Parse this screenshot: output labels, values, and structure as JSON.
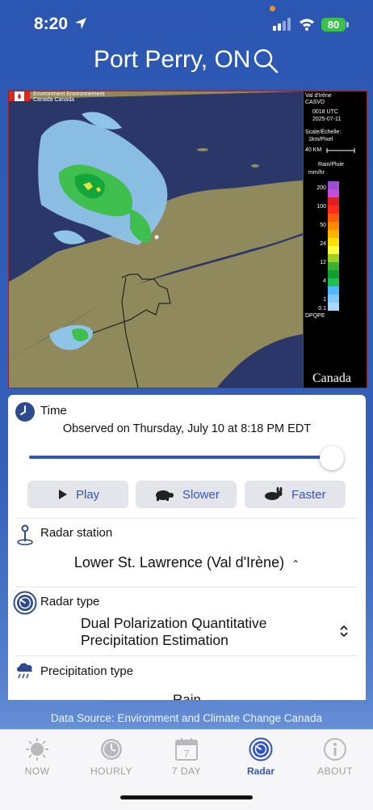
{
  "status_bar": {
    "time": "8:20",
    "battery": "80"
  },
  "header": {
    "title": "Port Perry, ON"
  },
  "radar": {
    "agency_label_line1": "Environment Environnement",
    "agency_label_line2": "Canada        Canada",
    "legend": {
      "station": "Val d'Irène",
      "station_code": "CASVD",
      "time": "0018 UTC",
      "date": "2025-07-11",
      "scale_label": "Scale/Échelle:",
      "scale_value": "1km/Pixel",
      "distance": "40 KM",
      "precip_label": "Rain/Pluie",
      "units": "mm/hr",
      "ticks": [
        "200",
        "100",
        "50",
        "24",
        "12",
        "4",
        "1",
        "0.1"
      ],
      "product": "DPQPE",
      "wordmark": "Canada"
    }
  },
  "time_section": {
    "label": "Time",
    "observed": "Observed on Thursday, July 10 at 8:18 PM EDT",
    "slider_position": 1.0
  },
  "playback": {
    "play": "Play",
    "slower": "Slower",
    "faster": "Faster"
  },
  "station_section": {
    "label": "Radar station",
    "value": "Lower St. Lawrence (Val d'Irène)"
  },
  "type_section": {
    "label": "Radar type",
    "value_line1": "Dual Polarization Quantitative",
    "value_line2": "Precipitation Estimation"
  },
  "precip_section": {
    "label": "Precipitation type",
    "value": "Rain"
  },
  "footer": {
    "data_source": "Data Source: Environment and Climate Change Canada"
  },
  "tabs": [
    {
      "label": "NOW",
      "icon": "sun-icon"
    },
    {
      "label": "HOURLY",
      "icon": "clock-icon"
    },
    {
      "label": "7 DAY",
      "icon": "calendar-icon",
      "day": "7"
    },
    {
      "label": "Radar",
      "icon": "radar-icon"
    },
    {
      "label": "ABOUT",
      "icon": "info-icon"
    }
  ],
  "colors": {
    "accent": "#2f55c0",
    "header_bg": "#2d5cb6",
    "inactive_tab": "#9c9ca1"
  }
}
